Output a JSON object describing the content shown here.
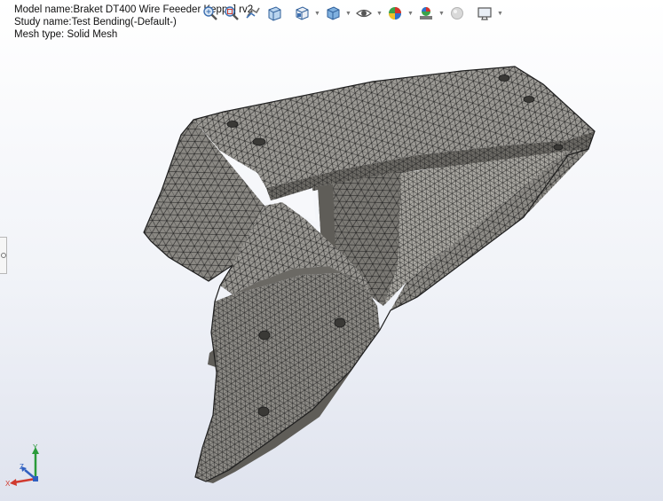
{
  "study_info": {
    "model_line": "Model name:Braket DT400 Wire Feeeder Keppp] rv2",
    "study_line": "Study name:Test Bending(-Default-)",
    "mesh_line": "Mesh type: Solid Mesh"
  },
  "toolbar": {
    "buttons": [
      {
        "name": "zoom-to-fit-icon"
      },
      {
        "name": "zoom-to-area-icon"
      },
      {
        "name": "previous-view-icon"
      },
      {
        "name": "section-view-icon"
      },
      {
        "name": "view-orientation-icon",
        "dropdown": true
      },
      {
        "name": "display-style-icon",
        "dropdown": true
      },
      {
        "name": "hide-show-items-icon",
        "dropdown": true
      },
      {
        "name": "edit-appearance-icon",
        "dropdown": true
      },
      {
        "name": "apply-scene-icon",
        "dropdown": true
      },
      {
        "name": "realview-graphics-icon"
      },
      {
        "name": "view-settings-icon",
        "dropdown": true
      }
    ]
  },
  "triad": {
    "x_label": "X",
    "y_label": "Y",
    "z_label": "Z"
  },
  "colors": {
    "mesh_fill": "#8d8b86",
    "mesh_dark": "#5f5d58",
    "mesh_light": "#b3b1ab",
    "mesh_line": "#1c1c1c",
    "background_top": "#ffffff",
    "background_bottom": "#dfe3ee"
  }
}
